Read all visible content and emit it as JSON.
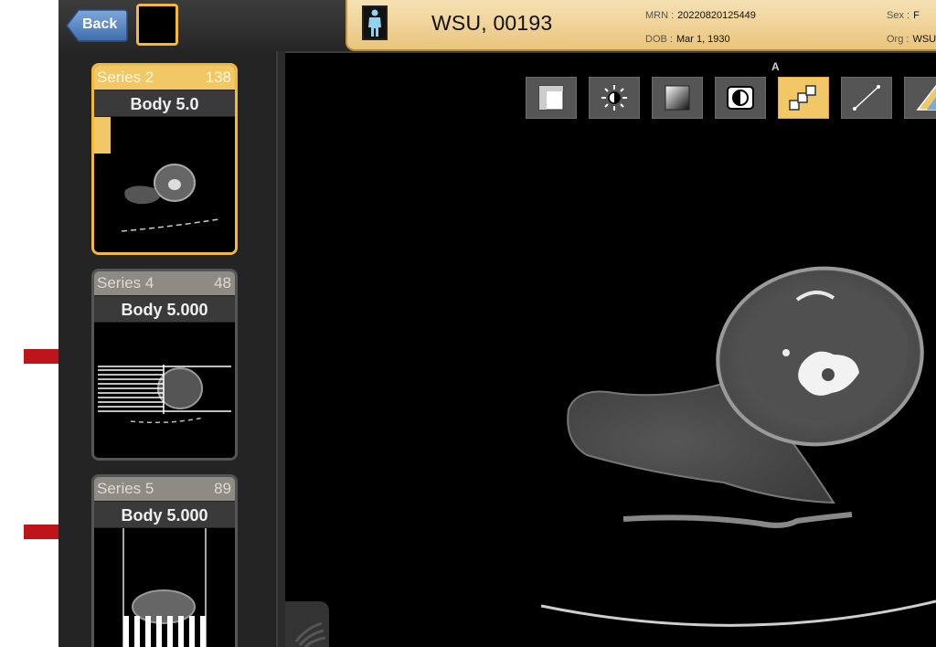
{
  "header": {
    "back_label": "Back",
    "patient_name": "WSU, 00193",
    "mrn_label": "MRN :",
    "mrn_value": "20220820125449",
    "dob_label": "DOB :",
    "dob_value": "Mar 1, 1930",
    "sex_label": "Sex :",
    "sex_value": "F",
    "org_label": "Org :",
    "org_value": "WSU"
  },
  "series": [
    {
      "name": "Series 2",
      "count": "138",
      "description": "Body 5.0",
      "selected": true
    },
    {
      "name": "Series 4",
      "count": "48",
      "description": "Body 5.000",
      "selected": false
    },
    {
      "name": "Series 5",
      "count": "89",
      "description": "Body 5.000",
      "selected": false
    }
  ],
  "viewer": {
    "orientation_label": "A",
    "toolbar": [
      {
        "icon": "layout-panel-icon"
      },
      {
        "icon": "brightness-icon"
      },
      {
        "icon": "window-level-icon"
      },
      {
        "icon": "invert-icon"
      },
      {
        "icon": "stack-scroll-icon",
        "selected": true
      },
      {
        "icon": "measure-line-icon"
      },
      {
        "icon": "angle-icon"
      }
    ]
  },
  "colors": {
    "accent": "#f2b93a",
    "header_gold": "#e9c57d",
    "arrow_red": "#c0141c"
  }
}
